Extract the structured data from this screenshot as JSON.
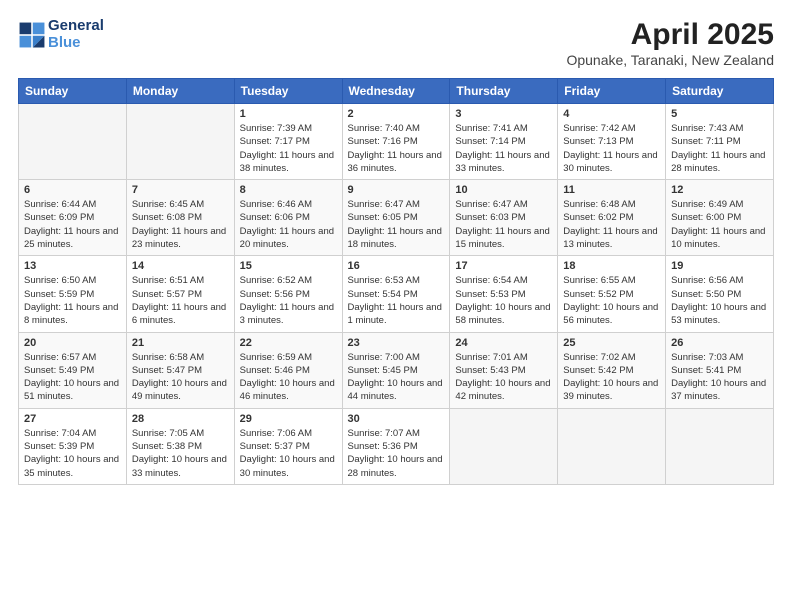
{
  "logo": {
    "line1": "General",
    "line2": "Blue"
  },
  "title": "April 2025",
  "subtitle": "Opunake, Taranaki, New Zealand",
  "weekdays": [
    "Sunday",
    "Monday",
    "Tuesday",
    "Wednesday",
    "Thursday",
    "Friday",
    "Saturday"
  ],
  "weeks": [
    [
      {
        "day": "",
        "info": ""
      },
      {
        "day": "",
        "info": ""
      },
      {
        "day": "1",
        "info": "Sunrise: 7:39 AM\nSunset: 7:17 PM\nDaylight: 11 hours and 38 minutes."
      },
      {
        "day": "2",
        "info": "Sunrise: 7:40 AM\nSunset: 7:16 PM\nDaylight: 11 hours and 36 minutes."
      },
      {
        "day": "3",
        "info": "Sunrise: 7:41 AM\nSunset: 7:14 PM\nDaylight: 11 hours and 33 minutes."
      },
      {
        "day": "4",
        "info": "Sunrise: 7:42 AM\nSunset: 7:13 PM\nDaylight: 11 hours and 30 minutes."
      },
      {
        "day": "5",
        "info": "Sunrise: 7:43 AM\nSunset: 7:11 PM\nDaylight: 11 hours and 28 minutes."
      }
    ],
    [
      {
        "day": "6",
        "info": "Sunrise: 6:44 AM\nSunset: 6:09 PM\nDaylight: 11 hours and 25 minutes."
      },
      {
        "day": "7",
        "info": "Sunrise: 6:45 AM\nSunset: 6:08 PM\nDaylight: 11 hours and 23 minutes."
      },
      {
        "day": "8",
        "info": "Sunrise: 6:46 AM\nSunset: 6:06 PM\nDaylight: 11 hours and 20 minutes."
      },
      {
        "day": "9",
        "info": "Sunrise: 6:47 AM\nSunset: 6:05 PM\nDaylight: 11 hours and 18 minutes."
      },
      {
        "day": "10",
        "info": "Sunrise: 6:47 AM\nSunset: 6:03 PM\nDaylight: 11 hours and 15 minutes."
      },
      {
        "day": "11",
        "info": "Sunrise: 6:48 AM\nSunset: 6:02 PM\nDaylight: 11 hours and 13 minutes."
      },
      {
        "day": "12",
        "info": "Sunrise: 6:49 AM\nSunset: 6:00 PM\nDaylight: 11 hours and 10 minutes."
      }
    ],
    [
      {
        "day": "13",
        "info": "Sunrise: 6:50 AM\nSunset: 5:59 PM\nDaylight: 11 hours and 8 minutes."
      },
      {
        "day": "14",
        "info": "Sunrise: 6:51 AM\nSunset: 5:57 PM\nDaylight: 11 hours and 6 minutes."
      },
      {
        "day": "15",
        "info": "Sunrise: 6:52 AM\nSunset: 5:56 PM\nDaylight: 11 hours and 3 minutes."
      },
      {
        "day": "16",
        "info": "Sunrise: 6:53 AM\nSunset: 5:54 PM\nDaylight: 11 hours and 1 minute."
      },
      {
        "day": "17",
        "info": "Sunrise: 6:54 AM\nSunset: 5:53 PM\nDaylight: 10 hours and 58 minutes."
      },
      {
        "day": "18",
        "info": "Sunrise: 6:55 AM\nSunset: 5:52 PM\nDaylight: 10 hours and 56 minutes."
      },
      {
        "day": "19",
        "info": "Sunrise: 6:56 AM\nSunset: 5:50 PM\nDaylight: 10 hours and 53 minutes."
      }
    ],
    [
      {
        "day": "20",
        "info": "Sunrise: 6:57 AM\nSunset: 5:49 PM\nDaylight: 10 hours and 51 minutes."
      },
      {
        "day": "21",
        "info": "Sunrise: 6:58 AM\nSunset: 5:47 PM\nDaylight: 10 hours and 49 minutes."
      },
      {
        "day": "22",
        "info": "Sunrise: 6:59 AM\nSunset: 5:46 PM\nDaylight: 10 hours and 46 minutes."
      },
      {
        "day": "23",
        "info": "Sunrise: 7:00 AM\nSunset: 5:45 PM\nDaylight: 10 hours and 44 minutes."
      },
      {
        "day": "24",
        "info": "Sunrise: 7:01 AM\nSunset: 5:43 PM\nDaylight: 10 hours and 42 minutes."
      },
      {
        "day": "25",
        "info": "Sunrise: 7:02 AM\nSunset: 5:42 PM\nDaylight: 10 hours and 39 minutes."
      },
      {
        "day": "26",
        "info": "Sunrise: 7:03 AM\nSunset: 5:41 PM\nDaylight: 10 hours and 37 minutes."
      }
    ],
    [
      {
        "day": "27",
        "info": "Sunrise: 7:04 AM\nSunset: 5:39 PM\nDaylight: 10 hours and 35 minutes."
      },
      {
        "day": "28",
        "info": "Sunrise: 7:05 AM\nSunset: 5:38 PM\nDaylight: 10 hours and 33 minutes."
      },
      {
        "day": "29",
        "info": "Sunrise: 7:06 AM\nSunset: 5:37 PM\nDaylight: 10 hours and 30 minutes."
      },
      {
        "day": "30",
        "info": "Sunrise: 7:07 AM\nSunset: 5:36 PM\nDaylight: 10 hours and 28 minutes."
      },
      {
        "day": "",
        "info": ""
      },
      {
        "day": "",
        "info": ""
      },
      {
        "day": "",
        "info": ""
      }
    ]
  ]
}
